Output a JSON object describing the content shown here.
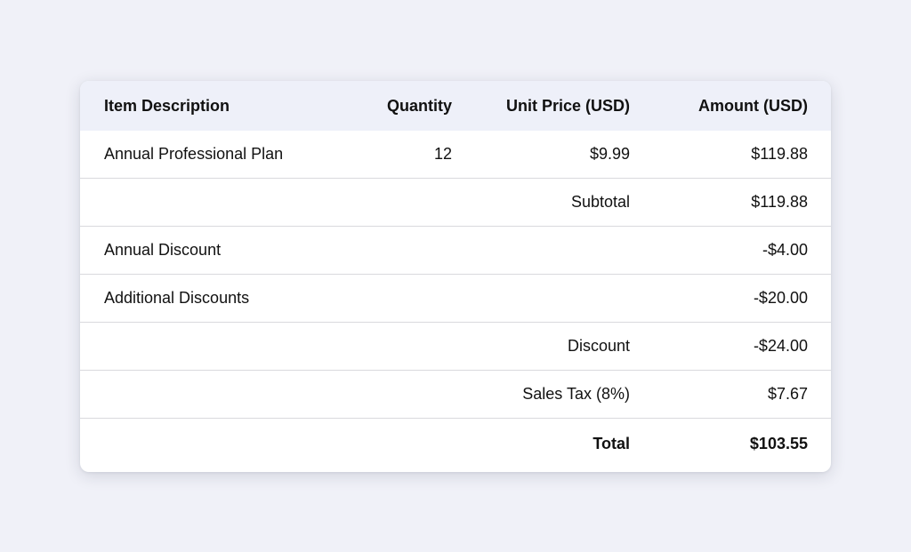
{
  "table": {
    "headers": {
      "description": "Item Description",
      "quantity": "Quantity",
      "unit_price": "Unit Price (USD)",
      "amount": "Amount (USD)"
    },
    "item": {
      "description": "Annual Professional Plan",
      "quantity": "12",
      "unit_price": "$9.99",
      "amount": "$119.88"
    },
    "subtotal": {
      "label": "Subtotal",
      "amount": "$119.88"
    },
    "discounts": [
      {
        "description": "Annual Discount",
        "amount": "-$4.00"
      },
      {
        "description": "Additional Discounts",
        "amount": "-$20.00"
      }
    ],
    "discount_total": {
      "label": "Discount",
      "amount": "-$24.00"
    },
    "sales_tax": {
      "label": "Sales Tax (8%)",
      "amount": "$7.67"
    },
    "total": {
      "label": "Total",
      "amount": "$103.55"
    }
  }
}
